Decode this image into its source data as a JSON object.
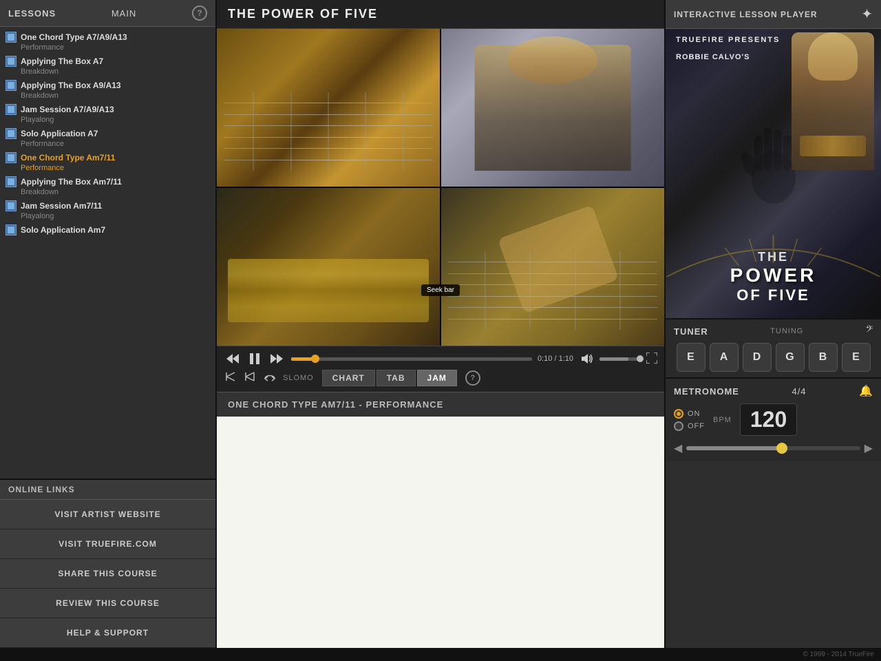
{
  "app": {
    "title": "THE POWER OF FIVE",
    "footer": "© 1999 - 2014 TrueFire"
  },
  "lessons_panel": {
    "title": "LESSONS",
    "main_label": "MAIN",
    "help_label": "?",
    "items": [
      {
        "id": 1,
        "title": "One Chord Type A7/A9/A13",
        "sub": "Performance",
        "active": false
      },
      {
        "id": 2,
        "title": "Applying The Box A7",
        "sub": "Breakdown",
        "active": false
      },
      {
        "id": 3,
        "title": "Applying The Box A9/A13",
        "sub": "Breakdown",
        "active": false
      },
      {
        "id": 4,
        "title": "Jam Session A7/A9/A13",
        "sub": "Playalong",
        "active": false
      },
      {
        "id": 5,
        "title": "Solo Application A7",
        "sub": "Performance",
        "active": false
      },
      {
        "id": 6,
        "title": "One Chord Type Am7/11",
        "sub": "Performance",
        "active": true
      },
      {
        "id": 7,
        "title": "Applying The Box Am7/11",
        "sub": "Breakdown",
        "active": false
      },
      {
        "id": 8,
        "title": "Jam Session Am7/11",
        "sub": "Playalong",
        "active": false
      },
      {
        "id": 9,
        "title": "Solo Application Am7",
        "sub": "",
        "active": false
      }
    ]
  },
  "online_links": {
    "header": "ONLINE LINKS",
    "buttons": [
      {
        "id": "visit-artist",
        "label": "VISIT ARTIST WEBSITE"
      },
      {
        "id": "visit-truefire",
        "label": "VISIT TRUEFIRE.COM"
      },
      {
        "id": "share",
        "label": "SHARE THIS COURSE"
      },
      {
        "id": "review",
        "label": "REVIEW THIS COURSE"
      },
      {
        "id": "help",
        "label": "HELP & SUPPORT"
      }
    ]
  },
  "video": {
    "title": "THE POWER OF FIVE",
    "time_current": "0:10",
    "time_total": "1:10",
    "seek_tooltip": "Seek bar",
    "controls": {
      "rewind": "⏮",
      "play": "▶",
      "forward": "⏭",
      "slomo_label": "SLOMO",
      "tab_chart": "CHART",
      "tab_tab": "TAB",
      "tab_jam": "JAM",
      "help": "?"
    }
  },
  "lesson_info": {
    "title": "ONE CHORD TYPE AM7/11 - PERFORMANCE"
  },
  "ilp": {
    "title": "INTERACTIVE LESSON PLAYER",
    "album": {
      "truefire_presents": "TRUEFIRE PRESENTS",
      "artist": "ROBBIE CALVO'S",
      "the_label": "THE",
      "power_label": "POWER",
      "of_five_label": "OF FIVE"
    }
  },
  "tuner": {
    "title": "TUNER",
    "tuning_label": "TUNING",
    "strings": [
      "E",
      "A",
      "D",
      "G",
      "B",
      "E"
    ]
  },
  "metronome": {
    "title": "METRONOME",
    "time_sig": "4/4",
    "on_label": "ON",
    "off_label": "OFF",
    "bpm_label": "BPM",
    "bpm_value": "120"
  }
}
